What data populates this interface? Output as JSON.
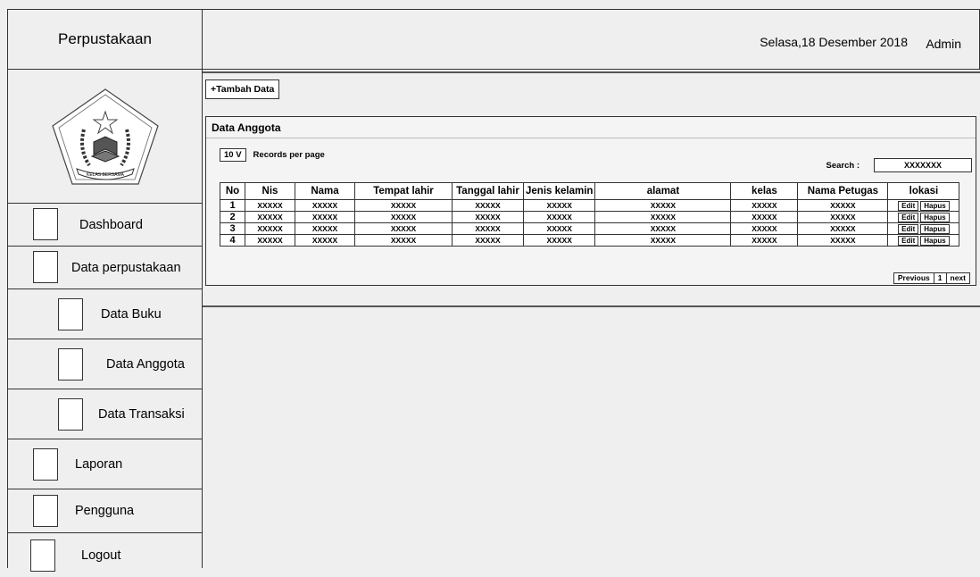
{
  "brand": {
    "title": "Perpustakaan"
  },
  "header": {
    "date": "Selasa,18 Desember 2018",
    "user": "Admin"
  },
  "logo": {
    "text": "KELAS BERSAMA"
  },
  "sidebar": {
    "items": [
      {
        "label": "Dashboard"
      },
      {
        "label": "Data perpustakaan"
      },
      {
        "label": "Data Buku"
      },
      {
        "label": "Data Anggota"
      },
      {
        "label": "Data Transaksi"
      },
      {
        "label": "Laporan"
      },
      {
        "label": "Pengguna"
      },
      {
        "label": "Logout"
      }
    ]
  },
  "content": {
    "add_button": "+Tambah Data",
    "panel_title": "Data Anggota",
    "records_select": "10  V",
    "records_label": "Records per page",
    "search_label": "Search :",
    "search_value": "XXXXXXX",
    "columns": [
      "No",
      "Nis",
      "Nama",
      "Tempat lahir",
      "Tanggal lahir",
      "Jenis kelamin",
      "alamat",
      "kelas",
      "Nama Petugas",
      "lokasi"
    ],
    "rows": [
      {
        "no": "1",
        "nis": "XXXXX",
        "nama": "XXXXX",
        "tempat": "XXXXX",
        "tanggal": "XXXXX",
        "jenis": "XXXXX",
        "alamat": "XXXXX",
        "kelas": "XXXXX",
        "petugas": "XXXXX"
      },
      {
        "no": "2",
        "nis": "XXXXX",
        "nama": "XXXXX",
        "tempat": "XXXXX",
        "tanggal": "XXXXX",
        "jenis": "XXXXX",
        "alamat": "XXXXX",
        "kelas": "XXXXX",
        "petugas": "XXXXX"
      },
      {
        "no": "3",
        "nis": "XXXXX",
        "nama": "XXXXX",
        "tempat": "XXXXX",
        "tanggal": "XXXXX",
        "jenis": "XXXXX",
        "alamat": "XXXXX",
        "kelas": "XXXXX",
        "petugas": "XXXXX"
      },
      {
        "no": "4",
        "nis": "XXXXX",
        "nama": "XXXXX",
        "tempat": "XXXXX",
        "tanggal": "XXXXX",
        "jenis": "XXXXX",
        "alamat": "XXXXX",
        "kelas": "XXXXX",
        "petugas": "XXXXX"
      }
    ],
    "edit_label": "Edit",
    "delete_label": "Hapus",
    "pager": {
      "previous": "Previous",
      "page": "1",
      "next": "next"
    }
  }
}
